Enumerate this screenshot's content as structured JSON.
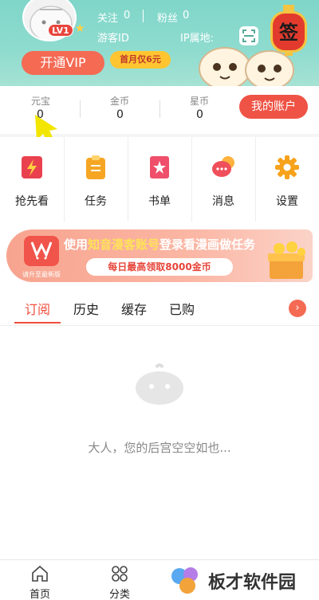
{
  "header": {
    "follow_label": "关注",
    "follow_count": "0",
    "fans_label": "粉丝",
    "fans_count": "0",
    "level": "LV1",
    "guest_id_label": "游客ID",
    "ip_label": "IP属地:",
    "vip_button": "开通VIP",
    "vip_promo": "首月仅6元",
    "sign_lantern": "签"
  },
  "currency": {
    "items": [
      {
        "label": "元宝",
        "value": "0"
      },
      {
        "label": "金币",
        "value": "0"
      },
      {
        "label": "星币",
        "value": "0"
      }
    ],
    "account_button": "我的账户"
  },
  "actions": [
    {
      "label": "抢先看",
      "icon": "lightning-book-icon"
    },
    {
      "label": "任务",
      "icon": "clipboard-icon"
    },
    {
      "label": "书单",
      "icon": "star-book-icon"
    },
    {
      "label": "消息",
      "icon": "chat-bubble-icon"
    },
    {
      "label": "设置",
      "icon": "gear-icon"
    }
  ],
  "banner": {
    "title_prefix": "使用",
    "title_highlight": "知音漫客账号",
    "title_suffix": "登录看漫画做任务",
    "subtitle": "每日最高领取8000金币",
    "logo_caption": "请升至最新版"
  },
  "tabs": [
    {
      "label": "订阅",
      "active": true
    },
    {
      "label": "历史",
      "active": false
    },
    {
      "label": "缓存",
      "active": false
    },
    {
      "label": "已购",
      "active": false
    }
  ],
  "empty_state": {
    "message": "大人，您的后宫空空如也..."
  },
  "bottom_nav": [
    {
      "label": "首页",
      "icon": "home-icon"
    },
    {
      "label": "分类",
      "icon": "category-icon"
    }
  ],
  "watermark": {
    "text": "板才软件园"
  },
  "colors": {
    "accent": "#f04e3e",
    "header_bg": "#8fdccf",
    "promo_yellow": "#ffc531"
  }
}
